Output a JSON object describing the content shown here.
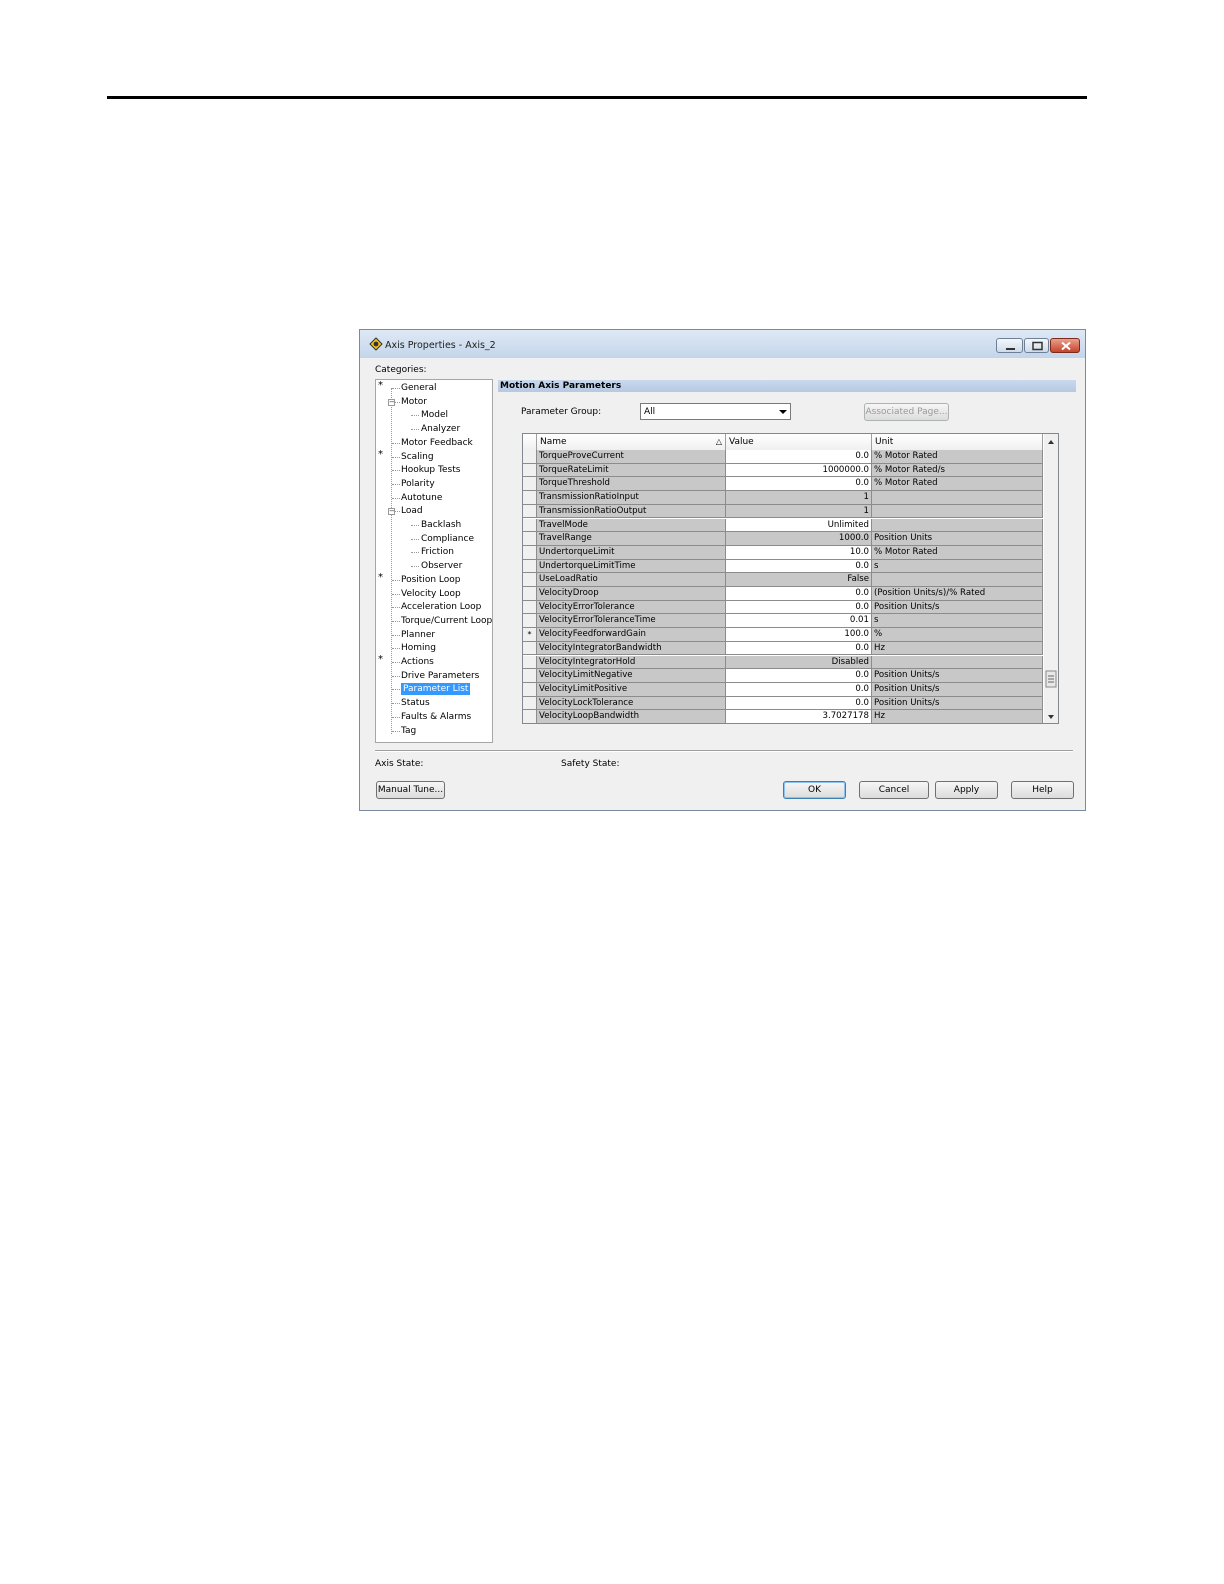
{
  "window": {
    "title": "Axis Properties - Axis_2"
  },
  "categories_label": "Categories:",
  "tree": [
    {
      "label": "General",
      "star": true
    },
    {
      "label": "Motor",
      "expanded": true
    },
    {
      "label": "Model",
      "child": true
    },
    {
      "label": "Analyzer",
      "child": true
    },
    {
      "label": "Motor Feedback"
    },
    {
      "label": "Scaling",
      "star": true
    },
    {
      "label": "Hookup Tests"
    },
    {
      "label": "Polarity"
    },
    {
      "label": "Autotune"
    },
    {
      "label": "Load",
      "expanded": true
    },
    {
      "label": "Backlash",
      "child": true
    },
    {
      "label": "Compliance",
      "child": true
    },
    {
      "label": "Friction",
      "child": true
    },
    {
      "label": "Observer",
      "child": true
    },
    {
      "label": "Position Loop",
      "star": true
    },
    {
      "label": "Velocity Loop"
    },
    {
      "label": "Acceleration Loop"
    },
    {
      "label": "Torque/Current Loop"
    },
    {
      "label": "Planner"
    },
    {
      "label": "Homing"
    },
    {
      "label": "Actions",
      "star": true
    },
    {
      "label": "Drive Parameters"
    },
    {
      "label": "Parameter List",
      "selected": true
    },
    {
      "label": "Status"
    },
    {
      "label": "Faults & Alarms"
    },
    {
      "label": "Tag"
    }
  ],
  "section_title": "Motion Axis Parameters",
  "parameter_group": {
    "label": "Parameter Group:",
    "value": "All"
  },
  "associated_page_button": "Associated Page...",
  "grid": {
    "columns": [
      "Name",
      "Value",
      "Unit"
    ],
    "sort_indicator": "△",
    "rows": [
      {
        "name": "TorqueProveCurrent",
        "value": "0.0",
        "unit": "% Motor Rated",
        "editable": true
      },
      {
        "name": "TorqueRateLimit",
        "value": "1000000.0",
        "unit": "% Motor Rated/s",
        "editable": true
      },
      {
        "name": "TorqueThreshold",
        "value": "0.0",
        "unit": "% Motor Rated",
        "editable": true
      },
      {
        "name": "TransmissionRatioInput",
        "value": "1",
        "unit": "",
        "editable": false
      },
      {
        "name": "TransmissionRatioOutput",
        "value": "1",
        "unit": "",
        "editable": false
      },
      {
        "name": "TravelMode",
        "value": "Unlimited",
        "unit": "",
        "editable": true
      },
      {
        "name": "TravelRange",
        "value": "1000.0",
        "unit": "Position Units",
        "editable": false
      },
      {
        "name": "UndertorqueLimit",
        "value": "10.0",
        "unit": "% Motor Rated",
        "editable": true
      },
      {
        "name": "UndertorqueLimitTime",
        "value": "0.0",
        "unit": "s",
        "editable": true
      },
      {
        "name": "UseLoadRatio",
        "value": "False",
        "unit": "",
        "editable": false
      },
      {
        "name": "VelocityDroop",
        "value": "0.0",
        "unit": "(Position Units/s)/% Rated",
        "editable": true
      },
      {
        "name": "VelocityErrorTolerance",
        "value": "0.0",
        "unit": "Position Units/s",
        "editable": true
      },
      {
        "name": "VelocityErrorToleranceTime",
        "value": "0.01",
        "unit": "s",
        "editable": true
      },
      {
        "name": "VelocityFeedforwardGain",
        "value": "100.0",
        "unit": "%",
        "editable": true,
        "marker": "*"
      },
      {
        "name": "VelocityIntegratorBandwidth",
        "value": "0.0",
        "unit": "Hz",
        "editable": true
      },
      {
        "name": "VelocityIntegratorHold",
        "value": "Disabled",
        "unit": "",
        "editable": false
      },
      {
        "name": "VelocityLimitNegative",
        "value": "0.0",
        "unit": "Position Units/s",
        "editable": true
      },
      {
        "name": "VelocityLimitPositive",
        "value": "0.0",
        "unit": "Position Units/s",
        "editable": true
      },
      {
        "name": "VelocityLockTolerance",
        "value": "0.0",
        "unit": "Position Units/s",
        "editable": true
      },
      {
        "name": "VelocityLoopBandwidth",
        "value": "3.7027178",
        "unit": "Hz",
        "editable": true
      }
    ]
  },
  "axis_state_label": "Axis State:",
  "safety_state_label": "Safety State:",
  "buttons": {
    "manual_tune": "Manual Tune...",
    "ok": "OK",
    "cancel": "Cancel",
    "apply": "Apply",
    "help": "Help"
  }
}
